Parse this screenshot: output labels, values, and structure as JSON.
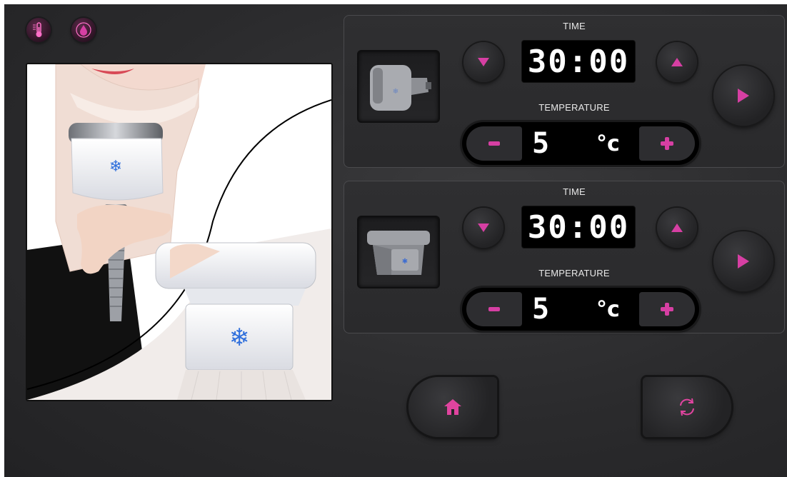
{
  "colors": {
    "accent": "#d63fa3",
    "accent_glow": "#ff5fc4",
    "background": "#2b2b2d",
    "display_bg": "#000000",
    "text": "#ffffff"
  },
  "status_icons": [
    {
      "name": "thermometer-icon"
    },
    {
      "name": "water-drop-icon"
    }
  ],
  "channels": [
    {
      "handpiece": "small-handpiece-icon",
      "time_label": "TIME",
      "time_value": "30:00",
      "temperature_label": "TEMPERATURE",
      "temperature_value": "5",
      "temperature_unit": "°c",
      "minus_label": "-",
      "plus_label": "+"
    },
    {
      "handpiece": "large-handpiece-icon",
      "time_label": "TIME",
      "time_value": "30:00",
      "temperature_label": "TEMPERATURE",
      "temperature_value": "5",
      "temperature_unit": "°c",
      "minus_label": "-",
      "plus_label": "+"
    }
  ],
  "bottom_buttons": [
    {
      "name": "home-icon"
    },
    {
      "name": "reset-icon"
    }
  ]
}
